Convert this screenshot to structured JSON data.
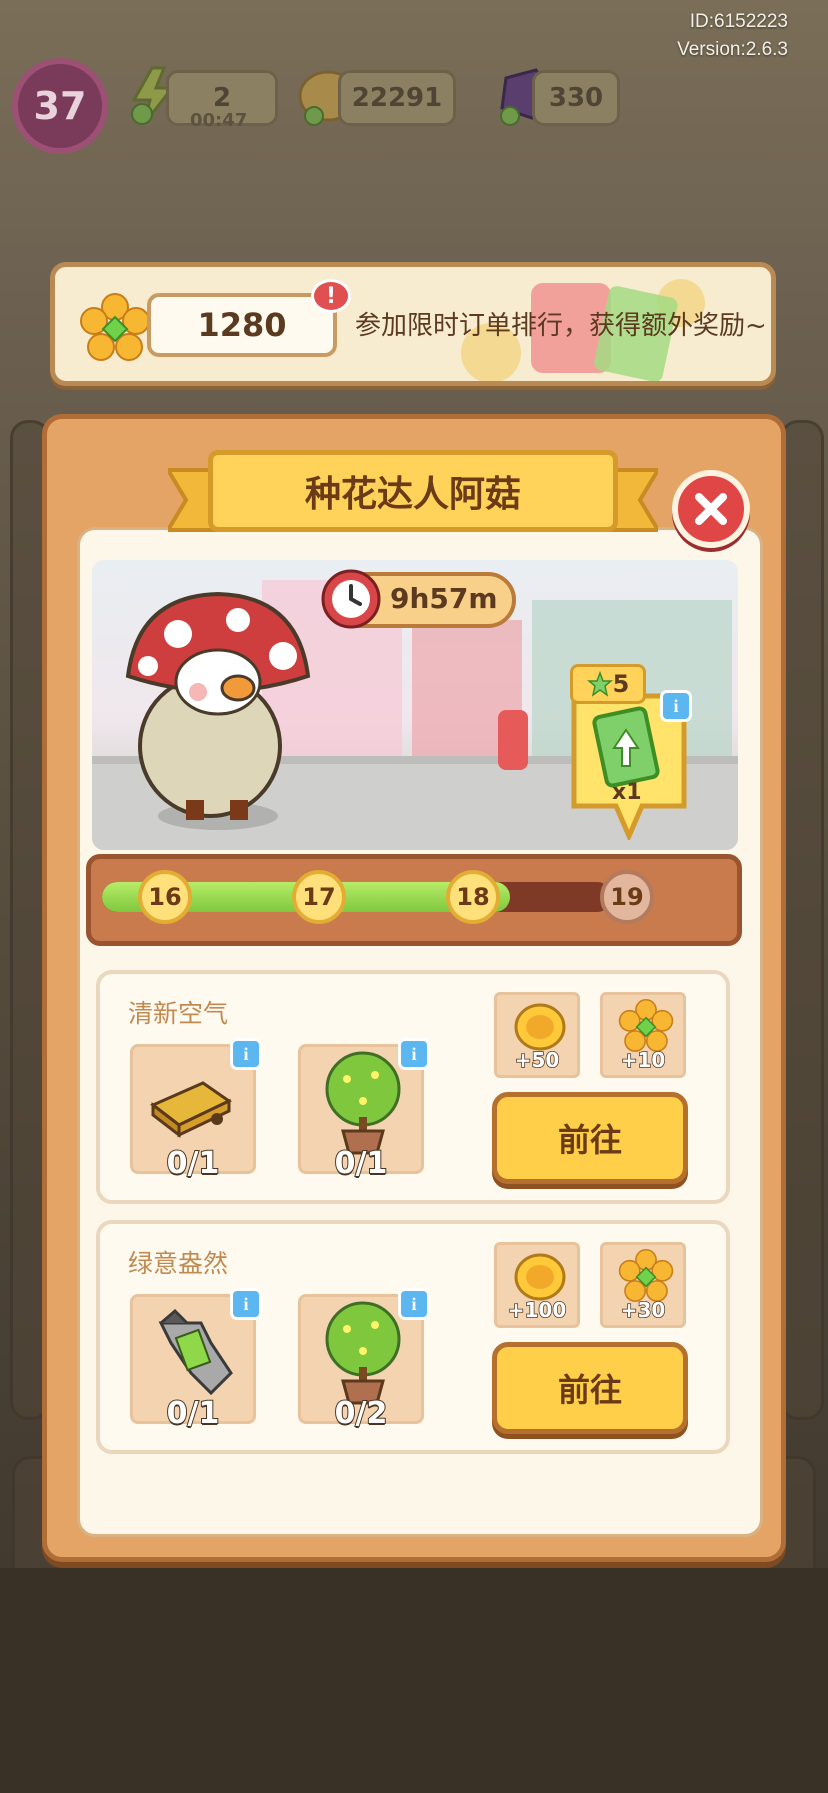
{
  "header": {
    "player_id": "ID:6152223",
    "version": "Version:2.6.3"
  },
  "top_bar": {
    "level": "37",
    "energy": "2",
    "energy_timer": "00:47",
    "coins": "22291",
    "gems": "330"
  },
  "event_banner": {
    "flower_count": "1280",
    "alert_mark": "!",
    "message": "参加限时订单排行，获得额外奖励~"
  },
  "popup": {
    "title": "种花达人阿菇",
    "timer": "9h57m",
    "milestone_reward": {
      "stars": "5",
      "quantity": "x1"
    },
    "progress": {
      "milestones": [
        "16",
        "17",
        "18",
        "19"
      ],
      "fraction": 0.8
    },
    "tasks": [
      {
        "title": "清新空气",
        "items": [
          {
            "icon": "wooden-planks-icon",
            "count": "0/1"
          },
          {
            "icon": "potted-tree-icon",
            "count": "0/1"
          }
        ],
        "rewards": [
          {
            "icon": "coin-icon",
            "amount": "+50"
          },
          {
            "icon": "flower-icon",
            "amount": "+10"
          }
        ],
        "button_label": "前往"
      },
      {
        "title": "绿意盎然",
        "items": [
          {
            "icon": "wrench-icon",
            "count": "0/1"
          },
          {
            "icon": "potted-tree-icon",
            "count": "0/2"
          }
        ],
        "rewards": [
          {
            "icon": "coin-icon",
            "amount": "+100"
          },
          {
            "icon": "flower-icon",
            "amount": "+30"
          }
        ],
        "button_label": "前往"
      }
    ]
  },
  "colors": {
    "popup_frame": "#e3a465",
    "ribbon": "#ffd35a",
    "progress_fill": "#7fc83d",
    "close_button": "#e04646",
    "info_badge": "#5cb6ef"
  }
}
